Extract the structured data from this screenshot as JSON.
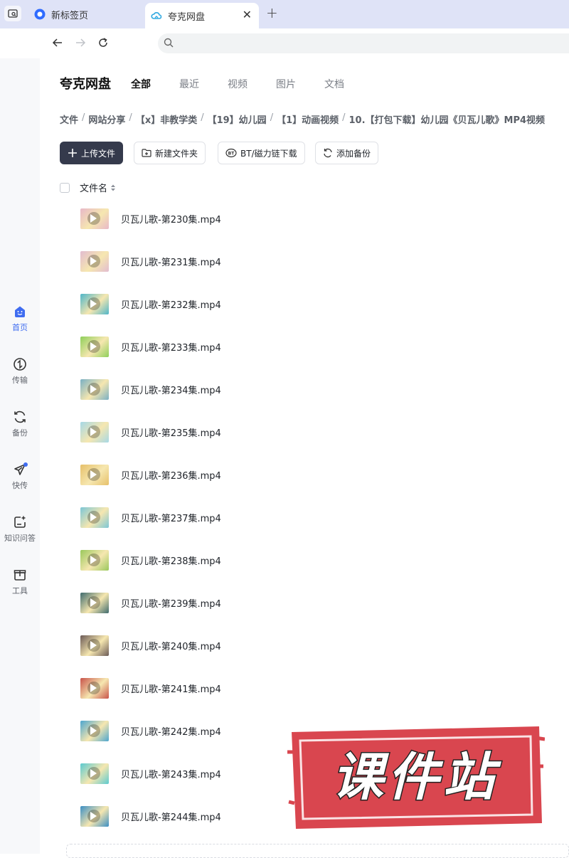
{
  "browser": {
    "tabs": [
      {
        "label": "新标签页",
        "active": false
      },
      {
        "label": "夸克网盘",
        "active": true
      }
    ],
    "address": ""
  },
  "sidebar": {
    "items": [
      {
        "label": "首页",
        "icon": "home-icon",
        "active": true
      },
      {
        "label": "传输",
        "icon": "transfer-icon",
        "active": false
      },
      {
        "label": "备份",
        "icon": "backup-icon",
        "active": false
      },
      {
        "label": "快传",
        "icon": "quick-send-icon",
        "active": false,
        "badge_dot": true
      },
      {
        "label": "知识问答",
        "icon": "knowledge-qa-icon",
        "active": false
      },
      {
        "label": "工具",
        "icon": "toolbox-icon",
        "active": false
      }
    ]
  },
  "header": {
    "title": "夸克网盘",
    "tabs": [
      "全部",
      "最近",
      "视频",
      "图片",
      "文档"
    ],
    "active_tab": "全部"
  },
  "breadcrumb": [
    "文件",
    "网站分享",
    "【x】非教学类",
    "【19】幼儿园",
    "【1】动画视频",
    "10.【打包下载】幼儿园《贝瓦儿歌》MP4视频"
  ],
  "toolbar": {
    "upload_label": "上传文件",
    "new_folder_label": "新建文件夹",
    "bt_label": "BT/磁力链下载",
    "backup_label": "添加备份"
  },
  "list": {
    "column_name": "文件名",
    "files": [
      {
        "name": "贝瓦儿歌-第230集.mp4",
        "thumb_color": "#e8b8c8"
      },
      {
        "name": "贝瓦儿歌-第231集.mp4",
        "thumb_color": "#e2bcd0"
      },
      {
        "name": "贝瓦儿歌-第232集.mp4",
        "thumb_color": "#4fb6c9"
      },
      {
        "name": "贝瓦儿歌-第233集.mp4",
        "thumb_color": "#8fcf5a"
      },
      {
        "name": "贝瓦儿歌-第234集.mp4",
        "thumb_color": "#7ab0c4"
      },
      {
        "name": "贝瓦儿歌-第235集.mp4",
        "thumb_color": "#a6d8e6"
      },
      {
        "name": "贝瓦儿歌-第236集.mp4",
        "thumb_color": "#e6c06a"
      },
      {
        "name": "贝瓦儿歌-第237集.mp4",
        "thumb_color": "#7cc6d6"
      },
      {
        "name": "贝瓦儿歌-第238集.mp4",
        "thumb_color": "#9ac85c"
      },
      {
        "name": "贝瓦儿歌-第239集.mp4",
        "thumb_color": "#3f6b6e"
      },
      {
        "name": "贝瓦儿歌-第240集.mp4",
        "thumb_color": "#6b5a56"
      },
      {
        "name": "贝瓦儿歌-第241集.mp4",
        "thumb_color": "#c8534a"
      },
      {
        "name": "贝瓦儿歌-第242集.mp4",
        "thumb_color": "#4da6cf"
      },
      {
        "name": "贝瓦儿歌-第243集.mp4",
        "thumb_color": "#5ccad0"
      },
      {
        "name": "贝瓦儿歌-第244集.mp4",
        "thumb_color": "#3c8fc4"
      }
    ]
  },
  "watermark": {
    "text": "课件站",
    "color": "#d9464f"
  }
}
